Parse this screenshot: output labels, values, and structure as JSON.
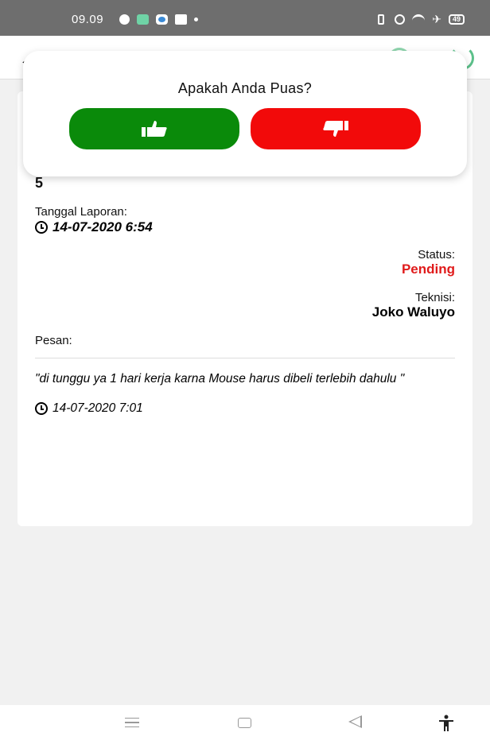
{
  "status_bar": {
    "time": "09.09",
    "battery": "49"
  },
  "report": {
    "number": "5",
    "date_label": "Tanggal Laporan:",
    "date_value": "14-07-2020 6:54",
    "status_label": "Status:",
    "status_value": "Pending",
    "technician_label": "Teknisi:",
    "technician_value": "Joko Waluyo",
    "message_label": "Pesan:",
    "message_text": "\"di tunggu ya 1 hari kerja karna Mouse harus dibeli terlebih dahulu \"",
    "message_time": "14-07-2020 7:01"
  },
  "dialog": {
    "title": "Apakah Anda Puas?",
    "yes_icon": "thumbs-up-icon",
    "no_icon": "thumbs-down-icon"
  },
  "colors": {
    "yes_button": "#0a8a0a",
    "no_button": "#f20a0a",
    "status_pending": "#e01b1b"
  }
}
